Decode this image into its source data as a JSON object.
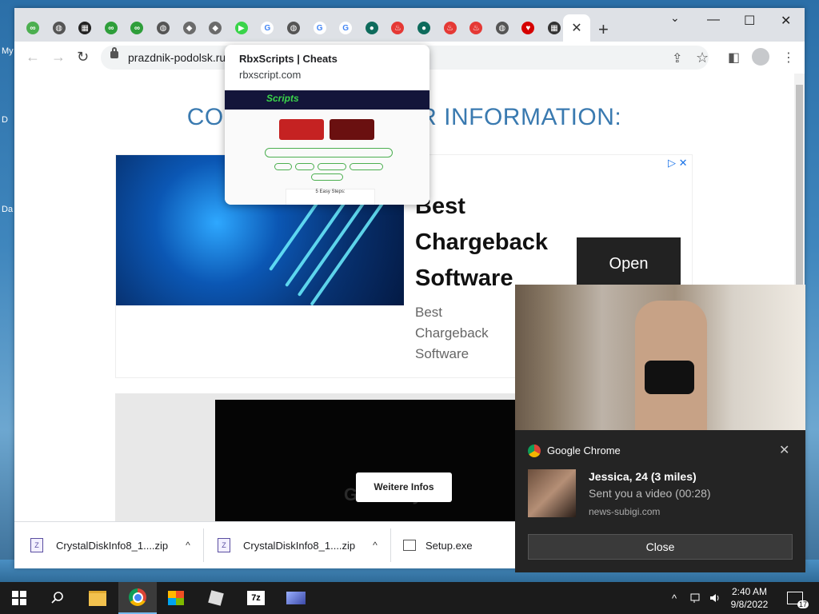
{
  "desktop": {
    "labels": [
      "My",
      "D",
      "Da"
    ]
  },
  "browser": {
    "tabs": [
      {
        "icon": "link-icon",
        "color": "#4caf50"
      },
      {
        "icon": "globe-icon",
        "color": "#555555"
      },
      {
        "icon": "grid-icon",
        "color": "#222222"
      },
      {
        "icon": "link-icon",
        "color": "#2e9e3a"
      },
      {
        "icon": "link-icon",
        "color": "#2e9e3a"
      },
      {
        "icon": "globe-icon",
        "color": "#555555"
      },
      {
        "icon": "roblox-icon",
        "color": "#6b6b6b"
      },
      {
        "icon": "roblox-icon",
        "color": "#6b6b6b"
      },
      {
        "icon": "scripts-icon",
        "color": "#3ad44a"
      },
      {
        "icon": "google-icon",
        "color": "#4285f4"
      },
      {
        "icon": "globe-icon",
        "color": "#555555"
      },
      {
        "icon": "google-icon",
        "color": "#4285f4"
      },
      {
        "icon": "google-icon",
        "color": "#4285f4"
      },
      {
        "icon": "circle-icon",
        "color": "#0e6b5c"
      },
      {
        "icon": "fire-icon",
        "color": "#e53935"
      },
      {
        "icon": "circle-icon",
        "color": "#0e6b5c"
      },
      {
        "icon": "fire-icon",
        "color": "#e53935"
      },
      {
        "icon": "fire-icon",
        "color": "#e53935"
      },
      {
        "icon": "globe-icon",
        "color": "#555555"
      },
      {
        "icon": "heart-icon",
        "color": "#d50000"
      },
      {
        "icon": "table-icon",
        "color": "#333333"
      }
    ],
    "glyphs": {
      "close": "✕",
      "new_tab": "+",
      "minimize": "—",
      "maximize": "☐",
      "chevron": "⌄",
      "back": "←",
      "forward": "→",
      "reload": "↻",
      "share": "⇪",
      "star": "☆",
      "sidebar": "◧",
      "menu": "⋮",
      "expand": "^"
    },
    "url": "prazdnik-podolsk.ru",
    "hover_card": {
      "title": "RbxScripts | Cheats",
      "url": "rbxscript.com",
      "logo": "Scripts",
      "steps": "5 Easy Steps:"
    }
  },
  "page": {
    "heading": "COMPLETE MEMBER INFORMATION:",
    "ad": {
      "title": "Best Chargeback Software",
      "desc": "Best Chargeback Software",
      "open_label": "Open",
      "choices": "▷ ✕"
    },
    "ad2": {
      "button": "Weitere Infos",
      "logo": "GoDaddy"
    }
  },
  "downloads": [
    {
      "name": "CrystalDiskInfo8_1....zip"
    },
    {
      "name": "CrystalDiskInfo8_1....zip"
    },
    {
      "name": "Setup.exe"
    }
  ],
  "notification": {
    "app": "Google Chrome",
    "title": "Jessica, 24 (3 miles)",
    "body": "Sent you a video (00:28)",
    "source": "news-subigi.com",
    "button": "Close"
  },
  "taskbar": {
    "items": [
      "search-icon",
      "file-explorer-icon",
      "chrome-icon",
      "store-icon",
      "roblox-icon",
      "7zip-icon",
      "app-icon"
    ],
    "seven_zip": "7z",
    "time": "2:40 AM",
    "date": "9/8/2022",
    "notif_count": "17"
  }
}
